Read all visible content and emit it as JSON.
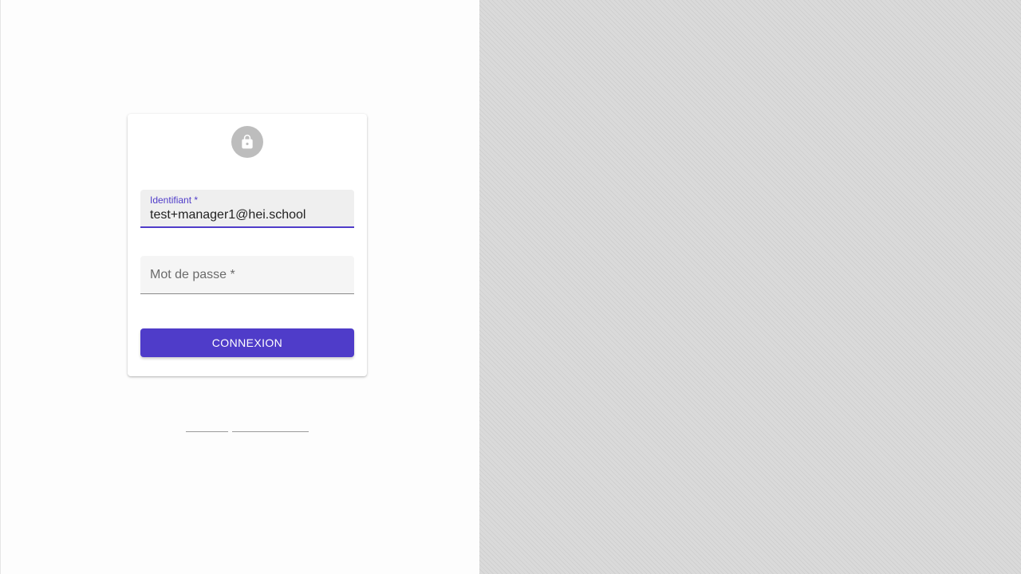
{
  "colors": {
    "accent": "#4f3cc9",
    "avatar_bg": "#bdbdbd",
    "stripe_bg": "#d6d6d6"
  },
  "login": {
    "icon": "lock-icon",
    "username": {
      "label": "Identifiant *",
      "value": "test+manager1@hei.school"
    },
    "password": {
      "label": "Mot de passe *",
      "value": ""
    },
    "submit_label": "CONNEXION"
  }
}
